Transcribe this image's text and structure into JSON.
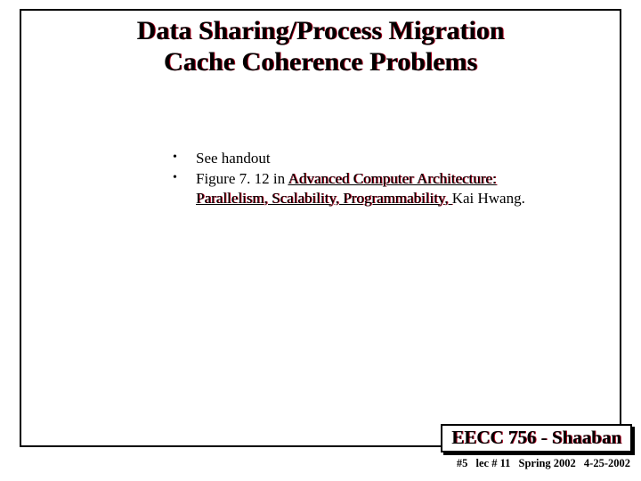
{
  "title": {
    "line1": "Data Sharing/Process Migration",
    "line2": "Cache Coherence Problems"
  },
  "bullets": {
    "items": [
      {
        "prefix": "",
        "plain": "See handout",
        "book": "",
        "tail": ""
      },
      {
        "prefix": "Figure 7. 12  in  ",
        "plain": "",
        "book": "Advanced Computer Architecture: Parallelism, Scalability, Programmability, ",
        "tail": "Kai Hwang."
      }
    ]
  },
  "footer": {
    "course": "EECC 756 - Shaaban",
    "slide_no": "#5",
    "lec": "lec # 11",
    "term": "Spring 2002",
    "date": "4-25-2002"
  }
}
